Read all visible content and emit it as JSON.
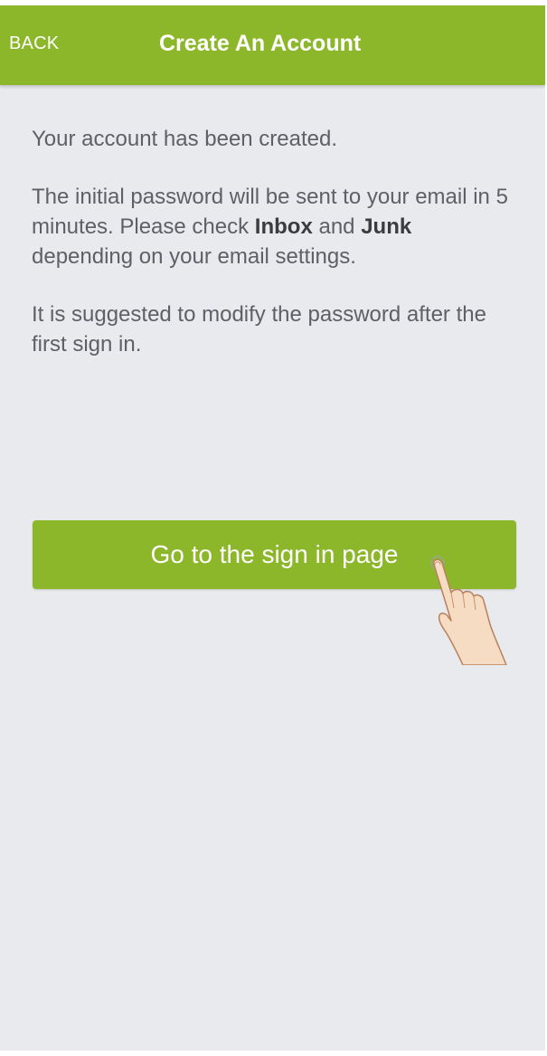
{
  "colors": {
    "brand_green": "#8db72a",
    "background": "#e8eaee",
    "body_text": "#5e6066"
  },
  "appbar": {
    "back_label": "BACK",
    "title": "Create An Account"
  },
  "message": {
    "line1": "Your account has been created.",
    "para2_part1": "The initial password will be sent to your email in 5 minutes. Please check ",
    "para2_inbox": "Inbox",
    "para2_part2": " and ",
    "para2_junk": "Junk",
    "para2_part3": " depending on your email settings.",
    "para3": "It is suggested to modify the password after the first sign in."
  },
  "cta": {
    "label": "Go to the sign in page"
  },
  "overlay": {
    "pointer_icon": "tap-hand-icon"
  }
}
